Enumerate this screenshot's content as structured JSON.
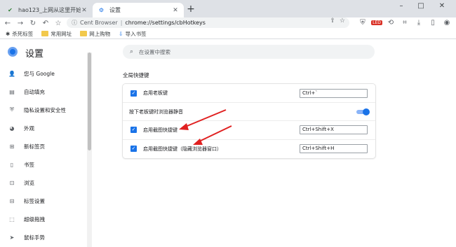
{
  "tabs": [
    {
      "title": "hao123_上网从这里开始",
      "active": false
    },
    {
      "title": "设置",
      "active": true
    }
  ],
  "address": {
    "host": "Cent Browser",
    "url": "chrome://settings/cbHotkeys"
  },
  "bookmarks": [
    {
      "label": "杀死标签",
      "icon": "kill-tab-icon"
    },
    {
      "label": "常用网址",
      "icon": "folder-icon"
    },
    {
      "label": "网上购物",
      "icon": "folder-icon"
    },
    {
      "label": "导入书签",
      "icon": "import-icon"
    }
  ],
  "extension_badge": "LED",
  "header": {
    "title": "设置",
    "search_placeholder": "在设置中搜索"
  },
  "sidebar": {
    "items": [
      {
        "label": "您与 Google",
        "icon": "person-icon"
      },
      {
        "label": "自动填充",
        "icon": "clipboard-icon"
      },
      {
        "label": "隐私设置和安全性",
        "icon": "shield-icon"
      },
      {
        "label": "外观",
        "icon": "palette-icon"
      },
      {
        "label": "新标签页",
        "icon": "newtab-icon"
      },
      {
        "label": "书签",
        "icon": "bookmark-icon"
      },
      {
        "label": "浏览",
        "icon": "browse-icon"
      },
      {
        "label": "标签设置",
        "icon": "tab-settings-icon"
      },
      {
        "label": "超级拖拽",
        "icon": "drag-icon"
      },
      {
        "label": "鼠标手势",
        "icon": "cursor-icon"
      }
    ]
  },
  "main": {
    "section_title": "全局快捷键",
    "rows": [
      {
        "label": "启用老板键",
        "checked": true,
        "hotkey": "Ctrl+`"
      },
      {
        "label": "按下老板键时浏览器静音",
        "toggle_on": true
      },
      {
        "label": "启用截图快捷键",
        "checked": true,
        "hotkey": "Ctrl+Shift+X"
      },
      {
        "label": "启用截图快捷键（隐藏浏览器窗口）",
        "checked": true,
        "hotkey": "Ctrl+Shift+H"
      }
    ]
  },
  "colors": {
    "accent": "#1a73e8",
    "annotation_arrow": "#e02020"
  }
}
